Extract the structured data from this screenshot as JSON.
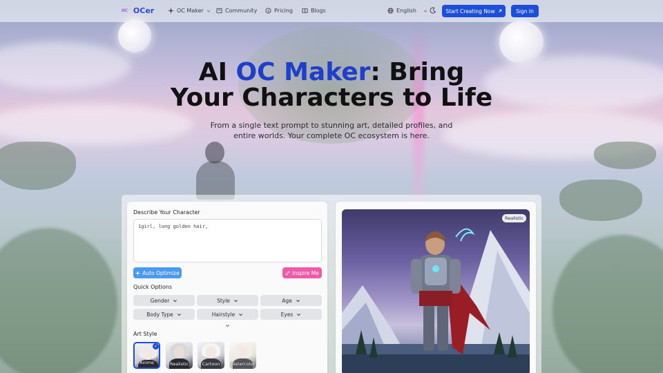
{
  "nav": {
    "logo_mark": "OC",
    "logo_text": "OCer",
    "items": [
      {
        "label": "OC Maker",
        "icon": "sparkles-icon",
        "dropdown": true
      },
      {
        "label": "Community",
        "icon": "community-icon"
      },
      {
        "label": "Pricing",
        "icon": "pricing-icon"
      },
      {
        "label": "Blogs",
        "icon": "book-icon"
      }
    ],
    "language": "English",
    "cta_label": "Start Creating Now",
    "signin_label": "Sign In"
  },
  "hero": {
    "title_part1": "AI ",
    "title_accent": "OC Maker",
    "title_part2": ": Bring",
    "title_line2": "Your Characters to Life",
    "subtitle": "From a single text prompt to stunning art, detailed profiles, and entire worlds. Your complete OC ecosystem is here."
  },
  "form": {
    "describe_label": "Describe Your Character",
    "prompt_value": "1girl, long golden hair,",
    "auto_optimize_label": "Auto Optimize",
    "inspire_label": "Inspire Me",
    "quick_options_label": "Quick Options",
    "options": [
      "Gender",
      "Style",
      "Age",
      "Body Type",
      "Hairstyle",
      "Eyes"
    ],
    "art_style_label": "Art Style",
    "art_styles": [
      "Anime",
      "Realistic",
      "Cartoon",
      "Watercolor"
    ],
    "selected_style": "Anime"
  },
  "preview": {
    "badge": "Realistic"
  },
  "colors": {
    "primary": "#1d4ed8",
    "accent_title": "#1e40c9",
    "auto_optimize": "#4a9af0",
    "inspire": "#ef5aa9"
  }
}
